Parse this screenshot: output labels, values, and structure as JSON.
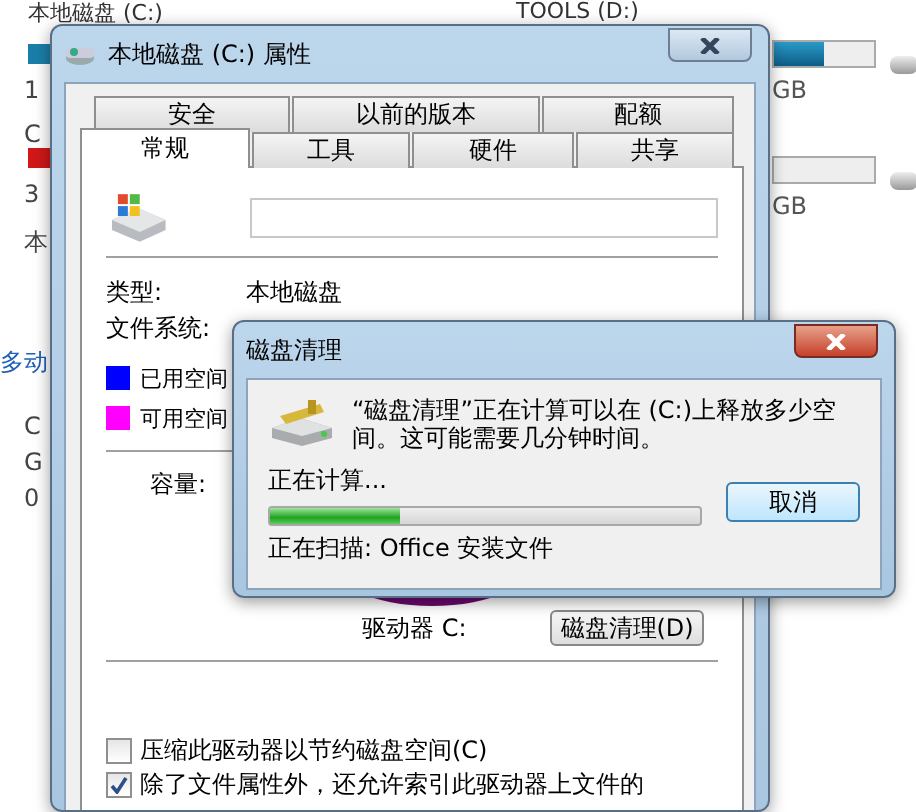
{
  "explorer": {
    "header_left": "本地磁盘 (C:)",
    "header_right": "TOOLS (D:)",
    "left_fragments": [
      {
        "text": "1",
        "kind": "text"
      },
      {
        "text": "C",
        "kind": "text"
      },
      {
        "text": "3",
        "kind": "text"
      },
      {
        "text": "本",
        "kind": "text"
      },
      {
        "text": "多动",
        "kind": "link"
      },
      {
        "text": "C",
        "kind": "text"
      },
      {
        "text": "G",
        "kind": "text"
      },
      {
        "text": "0",
        "kind": "text"
      }
    ],
    "left_bars": [
      {
        "color": "#1a7fa8"
      },
      {
        "color": "#d01818"
      }
    ],
    "right_fragments": [
      "GB",
      "GB"
    ]
  },
  "properties": {
    "title": "本地磁盘 (C:) 属性",
    "tabs_top": [
      {
        "label": "安全",
        "selected": false
      },
      {
        "label": "以前的版本",
        "selected": false
      },
      {
        "label": "配额",
        "selected": false
      }
    ],
    "tabs_bottom": [
      {
        "label": "常规",
        "selected": true
      },
      {
        "label": "工具",
        "selected": false
      },
      {
        "label": "硬件",
        "selected": false
      },
      {
        "label": "共享",
        "selected": false
      }
    ],
    "info": [
      {
        "label": "类型:",
        "value": "本地磁盘"
      },
      {
        "label": "文件系统:"
      }
    ],
    "legend": [
      {
        "label": "已用空间",
        "color": "#0000ff"
      },
      {
        "label": "可用空间",
        "color": "#ff00ff"
      }
    ],
    "capacity_label": "容量:",
    "drive_label": "驱动器 C:",
    "cleanup_button": "磁盘清理(D)",
    "options": [
      {
        "label": "压缩此驱动器以节约磁盘空间(C)",
        "checked": false
      },
      {
        "label": "除了文件属性外，还允许索引此驱动器上文件的",
        "checked": true
      }
    ]
  },
  "cleanup": {
    "title": "磁盘清理",
    "message": "“磁盘清理”正在计算可以在 (C:)上释放多少空间。这可能需要几分钟时间。",
    "status": "正在计算...",
    "level": 0.3,
    "cancel": "取消",
    "scanning": "正在扫描: Office 安装文件"
  }
}
